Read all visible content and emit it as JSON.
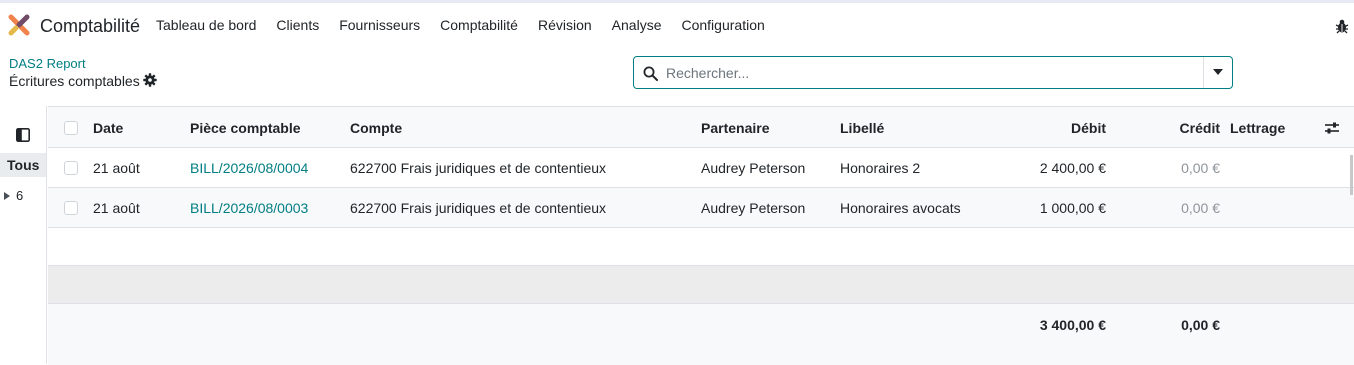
{
  "navbar": {
    "app_name": "Comptabilité",
    "menu": [
      "Tableau de bord",
      "Clients",
      "Fournisseurs",
      "Comptabilité",
      "Révision",
      "Analyse",
      "Configuration"
    ]
  },
  "control_panel": {
    "breadcrumb": "DAS2 Report",
    "title": "Écritures comptables",
    "search_placeholder": "Rechercher..."
  },
  "side_panel": {
    "all_label": "Tous",
    "groups": [
      {
        "label": "6"
      }
    ]
  },
  "table": {
    "columns": {
      "date": "Date",
      "move": "Pièce comptable",
      "account": "Compte",
      "partner": "Partenaire",
      "label": "Libellé",
      "debit": "Débit",
      "credit": "Crédit",
      "matching": "Lettrage"
    },
    "rows": [
      {
        "date": "21 août",
        "move": "BILL/2026/08/0004",
        "account": "622700 Frais juridiques et de contentieux",
        "partner": "Audrey Peterson",
        "label": "Honoraires 2",
        "debit": "2 400,00 €",
        "credit": "0,00 €"
      },
      {
        "date": "21 août",
        "move": "BILL/2026/08/0003",
        "account": "622700 Frais juridiques et de contentieux",
        "partner": "Audrey Peterson",
        "label": "Honoraires avocats",
        "debit": "1 000,00 €",
        "credit": "0,00 €"
      }
    ],
    "totals": {
      "debit": "3 400,00 €",
      "credit": "0,00 €"
    }
  },
  "colors": {
    "accent": "#017e84",
    "logo_orange": "#f0824b",
    "logo_purple": "#714b67"
  }
}
